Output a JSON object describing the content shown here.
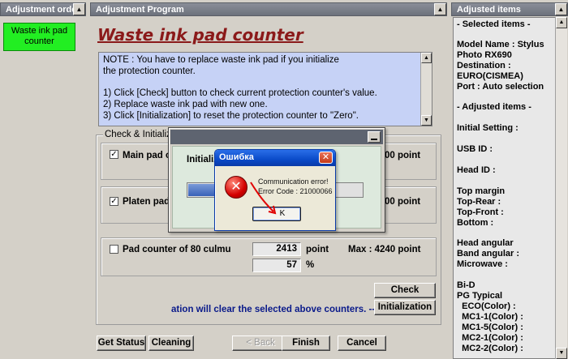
{
  "panels": {
    "left_title": "Adjustment order",
    "center_title": "Adjustment Program",
    "right_title": "Adjusted items"
  },
  "left": {
    "items": [
      {
        "label_line1": "Waste ink pad",
        "label_line2": "counter"
      }
    ]
  },
  "main": {
    "title": "Waste ink pad counter",
    "note_lines": [
      "NOTE : You have to replace waste ink pad if you initialize",
      "the protection counter.",
      "1) Click [Check] button to check current protection counter's value.",
      "2) Replace waste ink pad with new one.",
      "3) Click [Initialization] to reset the protection counter to \"Zero\"."
    ],
    "group_label": "Check & Initializ",
    "rows": [
      {
        "checked": true,
        "label": "Main pad c",
        "max_tail": "00 point"
      },
      {
        "checked": true,
        "label": "Platen pad",
        "max_tail": "00 point"
      },
      {
        "checked": false,
        "label": "Pad counter of 80 culmu",
        "value": "2413",
        "unit": "point",
        "max": "Max : 4240 point",
        "percent": "57",
        "percent_unit": "%"
      }
    ],
    "check_label": "Check",
    "init_note": "ation will clear the selected above counters. -->",
    "init_label": "Initialization",
    "bottom": {
      "get_status": "Get Status",
      "cleaning": "Cleaning",
      "back": "< Back",
      "finish": "Finish",
      "cancel": "Cancel"
    }
  },
  "right": {
    "lines": [
      "- Selected items -",
      "Model Name : Stylus",
      "Photo RX690",
      "Destination :",
      "EURO(CISMEA)",
      "Port : Auto selection",
      "- Adjusted items -",
      "Initial Setting :",
      "USB ID :",
      "Head ID :",
      "Top margin",
      "Top-Rear :",
      "Top-Front :",
      "Bottom :",
      "Head angular",
      "Band angular :",
      "Microwave :",
      "Bi-D",
      "PG Typical",
      "  ECO(Color) :",
      "  MC1-1(Color) :",
      "  MC1-5(Color) :",
      "  MC2-1(Color) :",
      "  MC2-2(Color) :"
    ]
  },
  "progress_dialog": {
    "label": "Initializ",
    "progress": 0.2
  },
  "error_dialog": {
    "title": "Ошибка",
    "message_line1": "Communication error!",
    "message_line2": "Error Code : 21000066",
    "ok_label": "K"
  },
  "colors": {
    "accent_green": "#22ee22",
    "title_red": "#8b1a1a",
    "note_blue": "#c6d2f6",
    "xp_blue": "#0a4ac8"
  }
}
